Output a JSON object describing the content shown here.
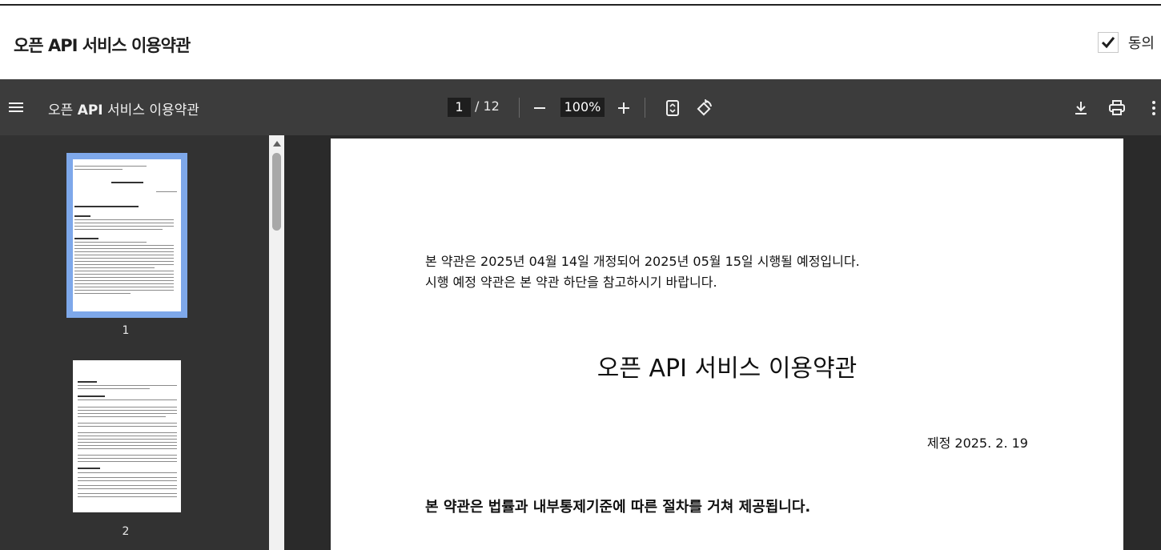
{
  "header": {
    "title": "오픈 API 서비스 이용약관",
    "agree_label": "동의",
    "agree_checked": true
  },
  "toolbar": {
    "doc_title_prefix": "오픈 ",
    "doc_title_bold": "API",
    "doc_title_suffix": " 서비스 이용약관",
    "current_page": "1",
    "total_pages": "/ 12",
    "zoom": "100%",
    "zoom_out_label": "−",
    "zoom_in_label": "+"
  },
  "sidebar": {
    "thumbnails": [
      {
        "page": "1"
      },
      {
        "page": "2"
      }
    ]
  },
  "document": {
    "notice_line1": "본 약관은 2025년 04월 14일 개정되어 2025년 05월 15일 시행될 예정입니다.",
    "notice_line2": "시행 예정 약관은 본 약관 하단을 참고하시기 바랍니다.",
    "title": "오픈 API 서비스 이용약관",
    "date": "제정 2025. 2. 19",
    "bold_statement": "본 약관은 법률과 내부통제기준에 따른 절차를 거쳐 제공됩니다."
  },
  "colors": {
    "toolbar_bg": "#3c3c3c",
    "sidebar_bg": "#323232",
    "viewer_bg": "#2a2a2a",
    "thumb_selected": "#7ea8ea"
  }
}
